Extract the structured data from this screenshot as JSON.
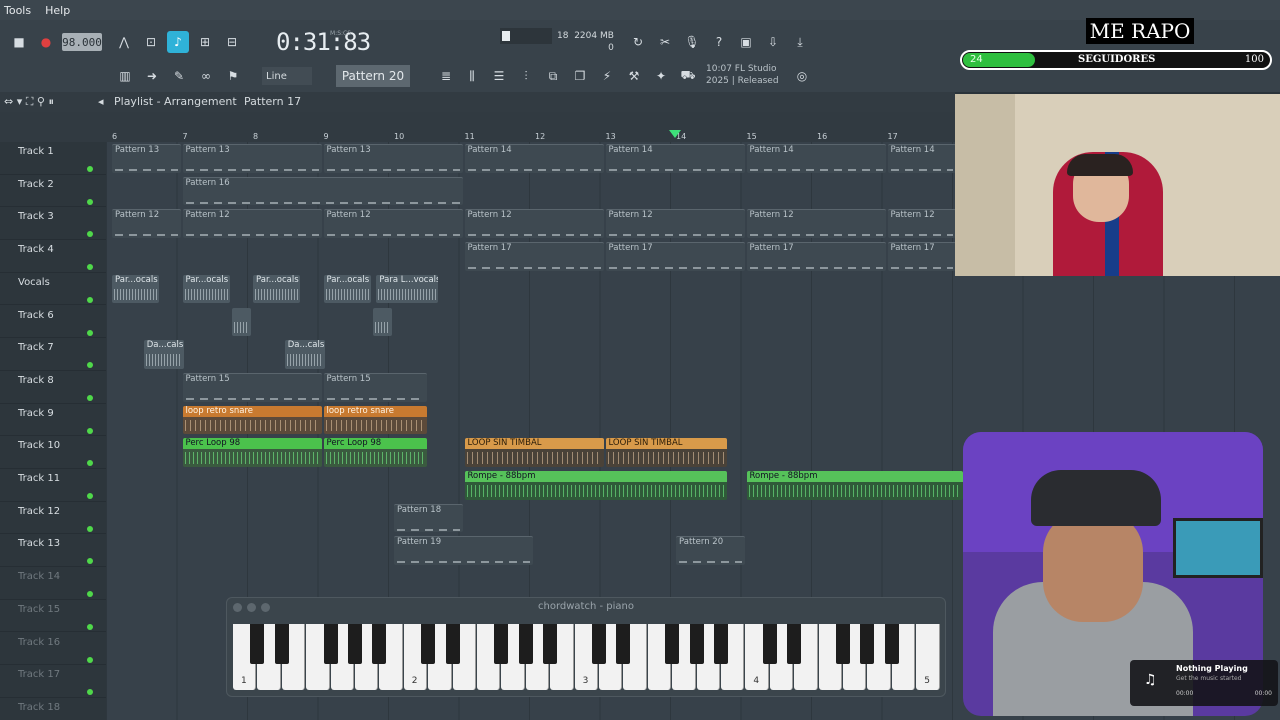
{
  "menu": [
    "Tools",
    "Help"
  ],
  "toolbar": {
    "tempo": "98.000",
    "time": "0:31:83",
    "time_label": "M:S:CS",
    "cpu": "18",
    "memory": "2204 MB",
    "voices": "0",
    "snap": "Line",
    "pattern": "Pattern 20",
    "version_line1": "10:07 FL Studio",
    "version_line2": "2025 | Released",
    "colors": {
      "active": "#2fb2d8"
    }
  },
  "overlay": {
    "title": "ME RAPO",
    "followers_count": "24",
    "followers_label": "SEGUIDORES",
    "followers_goal": "100",
    "followers_progress": 0.24
  },
  "playlist": {
    "title": "Playlist - Arrangement",
    "pattern": "Pattern 17",
    "ruler": [
      "6",
      "7",
      "8",
      "9",
      "10",
      "11",
      "12",
      "13",
      "14",
      "15",
      "16",
      "17"
    ],
    "tracks": [
      {
        "name": "Track 1"
      },
      {
        "name": "Track 2"
      },
      {
        "name": "Track 3"
      },
      {
        "name": "Track 4"
      },
      {
        "name": "Vocals"
      },
      {
        "name": "Track 6"
      },
      {
        "name": "Track 7"
      },
      {
        "name": "Track 8"
      },
      {
        "name": "Track 9"
      },
      {
        "name": "Track 10"
      },
      {
        "name": "Track 11"
      },
      {
        "name": "Track 12"
      },
      {
        "name": "Track 13"
      },
      {
        "name": "Track 14"
      },
      {
        "name": "Track 15"
      },
      {
        "name": "Track 16"
      },
      {
        "name": "Track 17"
      },
      {
        "name": "Track 18"
      }
    ],
    "clips": [
      {
        "track": 0,
        "start": 0,
        "len": 1,
        "label": "Pattern 13",
        "kind": "pattern"
      },
      {
        "track": 0,
        "start": 1,
        "len": 2,
        "label": "Pattern 13",
        "kind": "pattern"
      },
      {
        "track": 0,
        "start": 3,
        "len": 2,
        "label": "Pattern 13",
        "kind": "pattern"
      },
      {
        "track": 0,
        "start": 5,
        "len": 2,
        "label": "Pattern 14",
        "kind": "pattern"
      },
      {
        "track": 0,
        "start": 7,
        "len": 2,
        "label": "Pattern 14",
        "kind": "pattern"
      },
      {
        "track": 0,
        "start": 9,
        "len": 2,
        "label": "Pattern 14",
        "kind": "pattern"
      },
      {
        "track": 0,
        "start": 11,
        "len": 1,
        "label": "Pattern 14",
        "kind": "pattern"
      },
      {
        "track": 1,
        "start": 1,
        "len": 4,
        "label": "Pattern 16",
        "kind": "pattern"
      },
      {
        "track": 2,
        "start": 0,
        "len": 1,
        "label": "Pattern 12",
        "kind": "pattern"
      },
      {
        "track": 2,
        "start": 1,
        "len": 2,
        "label": "Pattern 12",
        "kind": "pattern"
      },
      {
        "track": 2,
        "start": 3,
        "len": 2,
        "label": "Pattern 12",
        "kind": "pattern"
      },
      {
        "track": 2,
        "start": 5,
        "len": 2,
        "label": "Pattern 12",
        "kind": "pattern"
      },
      {
        "track": 2,
        "start": 7,
        "len": 2,
        "label": "Pattern 12",
        "kind": "pattern"
      },
      {
        "track": 2,
        "start": 9,
        "len": 2,
        "label": "Pattern 12",
        "kind": "pattern"
      },
      {
        "track": 2,
        "start": 11,
        "len": 1,
        "label": "Pattern 12",
        "kind": "pattern"
      },
      {
        "track": 3,
        "start": 5,
        "len": 2,
        "label": "Pattern 17",
        "kind": "pattern"
      },
      {
        "track": 3,
        "start": 7,
        "len": 2,
        "label": "Pattern 17",
        "kind": "pattern"
      },
      {
        "track": 3,
        "start": 9,
        "len": 2,
        "label": "Pattern 17",
        "kind": "pattern"
      },
      {
        "track": 3,
        "start": 11,
        "len": 1,
        "label": "Pattern 17",
        "kind": "pattern"
      },
      {
        "track": 4,
        "start": 0,
        "len": 0.7,
        "label": "Par...ocals",
        "kind": "audio"
      },
      {
        "track": 4,
        "start": 1,
        "len": 0.7,
        "label": "Par...ocals",
        "kind": "audio"
      },
      {
        "track": 4,
        "start": 2,
        "len": 0.7,
        "label": "Par...ocals",
        "kind": "audio"
      },
      {
        "track": 4,
        "start": 3,
        "len": 0.7,
        "label": "Par...ocals",
        "kind": "audio"
      },
      {
        "track": 4,
        "start": 3.75,
        "len": 0.9,
        "label": "Para L...vocals",
        "kind": "audio"
      },
      {
        "track": 5,
        "start": 1.7,
        "len": 0.3,
        "label": "",
        "kind": "audio"
      },
      {
        "track": 5,
        "start": 3.7,
        "len": 0.3,
        "label": "",
        "kind": "audio"
      },
      {
        "track": 6,
        "start": 0.45,
        "len": 0.6,
        "label": "Da...cals",
        "kind": "audio"
      },
      {
        "track": 6,
        "start": 2.45,
        "len": 0.6,
        "label": "Da...cals",
        "kind": "audio"
      },
      {
        "track": 7,
        "start": 1,
        "len": 2,
        "label": "Pattern 15",
        "kind": "pattern"
      },
      {
        "track": 7,
        "start": 3,
        "len": 1.5,
        "label": "Pattern 15",
        "kind": "pattern"
      },
      {
        "track": 8,
        "start": 1,
        "len": 2,
        "label": "loop retro snare",
        "kind": "orange"
      },
      {
        "track": 8,
        "start": 3,
        "len": 1.5,
        "label": "loop retro snare",
        "kind": "orange"
      },
      {
        "track": 9,
        "start": 1,
        "len": 2,
        "label": "Perc Loop 98",
        "kind": "green"
      },
      {
        "track": 9,
        "start": 3,
        "len": 1.5,
        "label": "Perc Loop 98",
        "kind": "green"
      },
      {
        "track": 9,
        "start": 5,
        "len": 2,
        "label": "LOOP SIN TIMBAL",
        "kind": "ltorange"
      },
      {
        "track": 9,
        "start": 7,
        "len": 1.75,
        "label": "LOOP SIN TIMBAL",
        "kind": "ltorange"
      },
      {
        "track": 10,
        "start": 5,
        "len": 3.75,
        "label": "Rompe - 88bpm",
        "kind": "ltgreen"
      },
      {
        "track": 10,
        "start": 9,
        "len": 3.1,
        "label": "Rompe - 88bpm",
        "kind": "ltgreen"
      },
      {
        "track": 11,
        "start": 4,
        "len": 1.0,
        "label": "Pattern 18",
        "kind": "pattern"
      },
      {
        "track": 12,
        "start": 4,
        "len": 2.0,
        "label": "Pattern 19",
        "kind": "pattern"
      },
      {
        "track": 12,
        "start": 8,
        "len": 1.0,
        "label": "Pattern 20",
        "kind": "pattern"
      }
    ]
  },
  "piano": {
    "title": "chordwatch - piano",
    "octaves": [
      "1",
      "2",
      "3",
      "4",
      "5"
    ]
  },
  "now_playing": {
    "title": "Nothing Playing",
    "subtitle": "Get the music started",
    "start": "00:00",
    "end": "00:00"
  }
}
